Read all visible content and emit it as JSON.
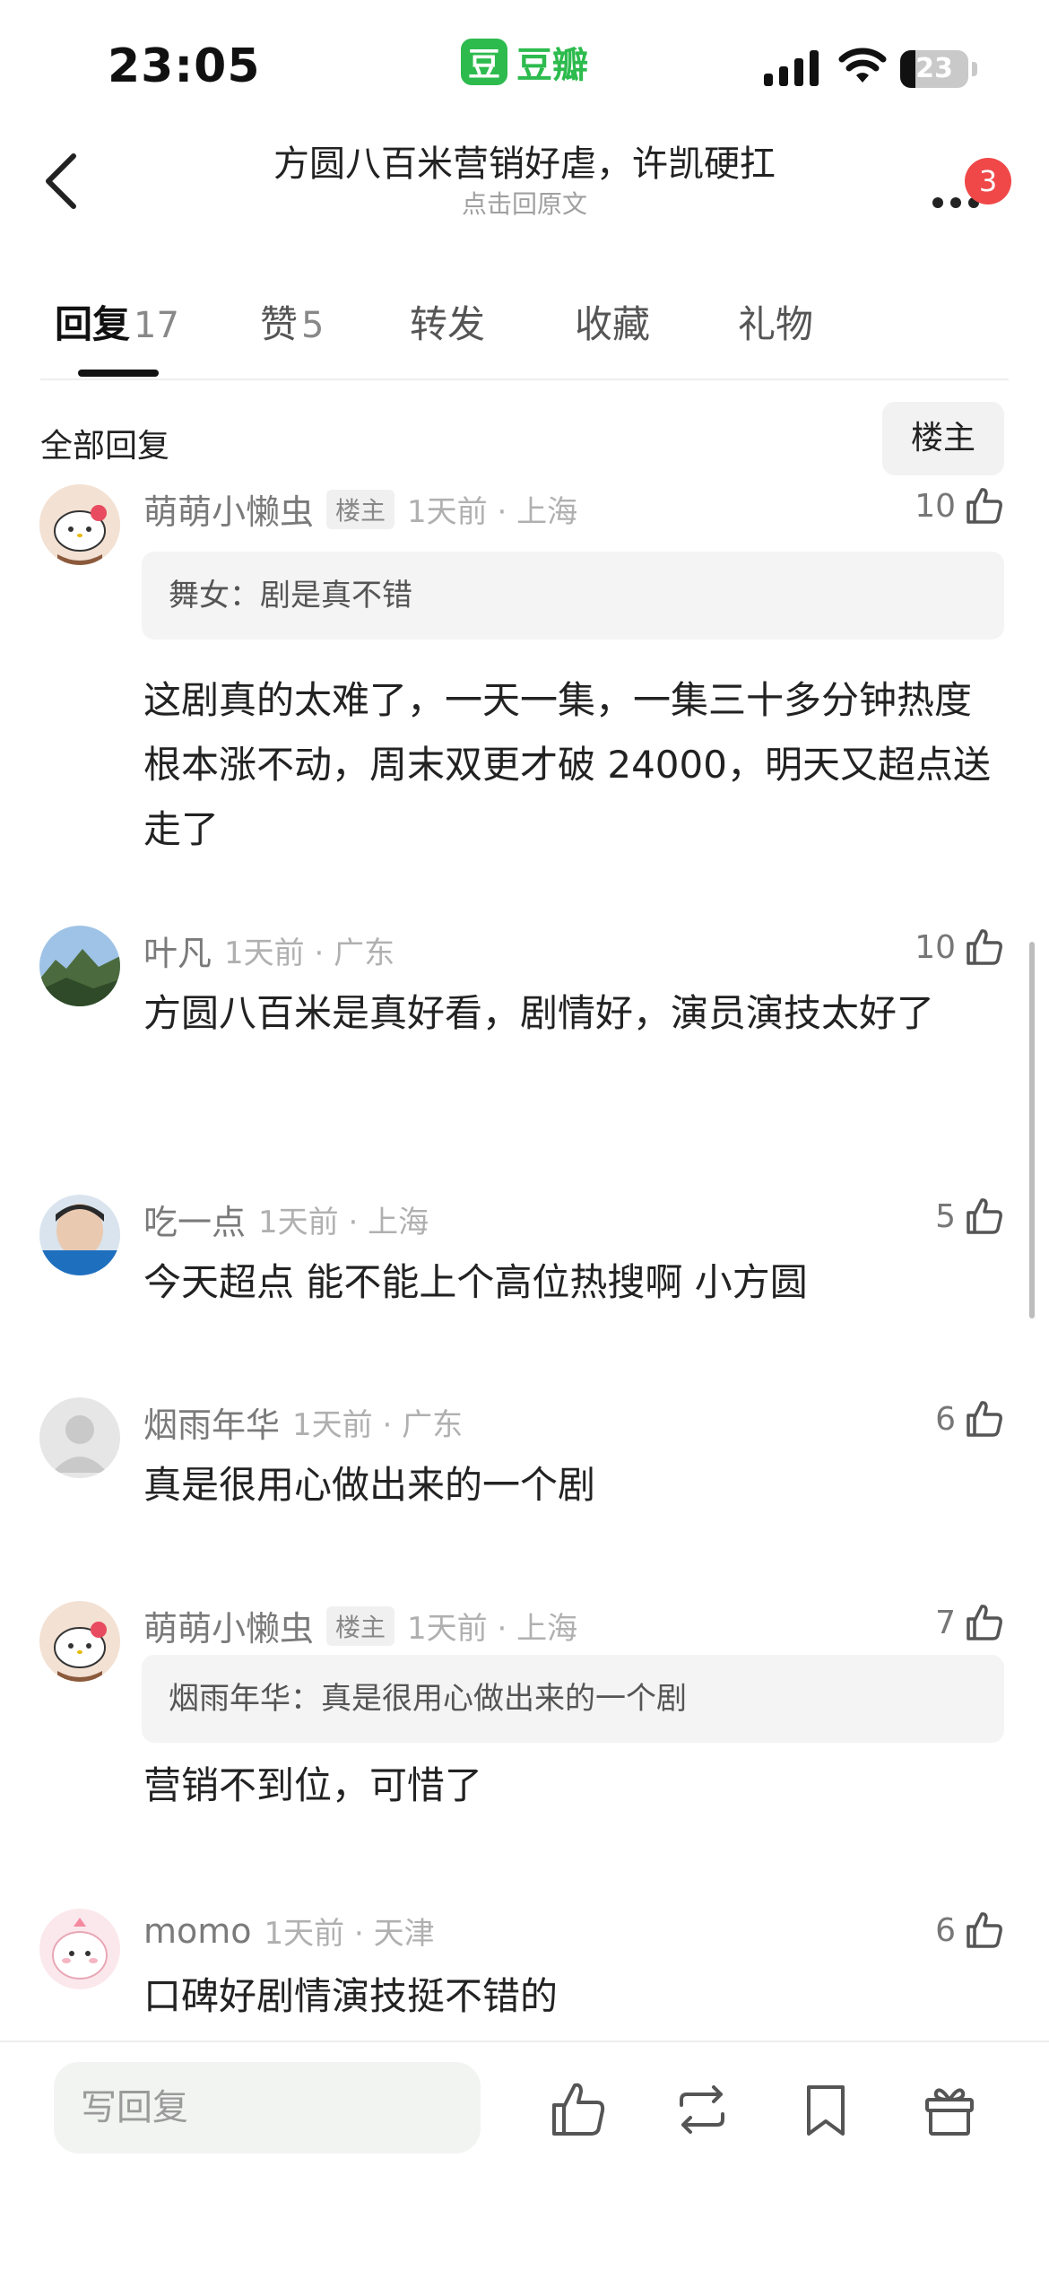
{
  "status_bar": {
    "time": "23:05",
    "app_logo_char": "豆",
    "app_name": "豆瓣",
    "battery_level": 23,
    "battery_text": "23"
  },
  "nav": {
    "title": "方圆八百米营销好虐，许凯硬扛",
    "subtitle": "点击回原文",
    "notification_count": "3"
  },
  "tabs": [
    {
      "label": "回复",
      "count": "17"
    },
    {
      "label": "赞",
      "count": "5"
    },
    {
      "label": "转发",
      "count": ""
    },
    {
      "label": "收藏",
      "count": ""
    },
    {
      "label": "礼物",
      "count": ""
    }
  ],
  "section": {
    "title": "全部回复",
    "filter_label": "楼主"
  },
  "comments": [
    {
      "author": "萌萌小懒虫",
      "op_tag": "楼主",
      "meta": "1天前 · 上海",
      "likes": "10",
      "quote": "舞女：剧是真不错",
      "text": "这剧真的太难了，一天一集，一集三十多分钟热度根本涨不动，周末双更才破 24000，明天又超点送走了"
    },
    {
      "author": "叶凡",
      "meta": "1天前 · 广东",
      "likes": "10",
      "text": "方圆八百米是真好看，剧情好，演员演技太好了"
    },
    {
      "author": "吃一点",
      "meta": "1天前 · 上海",
      "likes": "5",
      "text": "今天超点 能不能上个高位热搜啊 小方圆"
    },
    {
      "author": "烟雨年华",
      "meta": "1天前 · 广东",
      "likes": "6",
      "text": "真是很用心做出来的一个剧"
    },
    {
      "author": "萌萌小懒虫",
      "op_tag": "楼主",
      "meta": "1天前 · 上海",
      "likes": "7",
      "quote": "烟雨年华：真是很用心做出来的一个剧",
      "text": "营销不到位，可惜了"
    },
    {
      "author": "momo",
      "meta": "1天前 · 天津",
      "likes": "6",
      "text": "口碑好剧情演技挺不错的"
    }
  ],
  "bottom_bar": {
    "reply_placeholder": "写回复"
  },
  "colors": {
    "brand_green": "#2dbb4e",
    "badge_red": "#f04848"
  }
}
